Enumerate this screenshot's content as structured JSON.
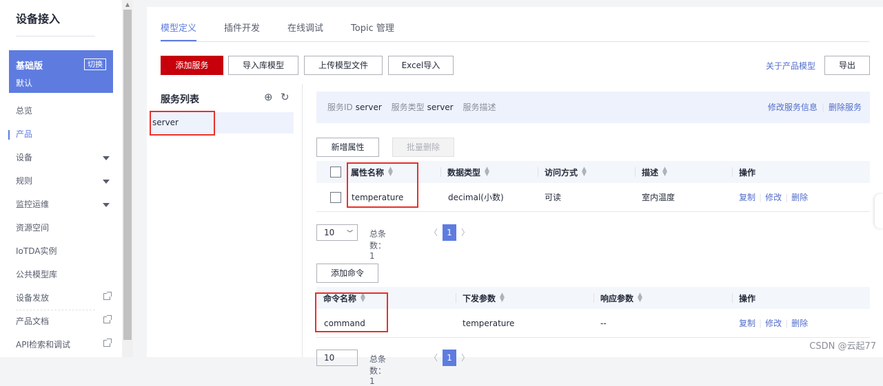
{
  "sidebar": {
    "title": "设备接入",
    "edition": {
      "name": "基础版",
      "sub": "默认",
      "switch": "切换"
    },
    "items": [
      {
        "label": "总览"
      },
      {
        "label": "产品"
      },
      {
        "label": "设备"
      },
      {
        "label": "规则"
      },
      {
        "label": "监控运维"
      },
      {
        "label": "资源空间"
      },
      {
        "label": "IoTDA实例"
      },
      {
        "label": "公共模型库"
      },
      {
        "label": "设备发放"
      },
      {
        "label": "产品文档"
      },
      {
        "label": "API检索和调试"
      }
    ]
  },
  "tabs": [
    "模型定义",
    "插件开发",
    "在线调试",
    "Topic 管理"
  ],
  "toolbar": {
    "add_service": "添加服务",
    "import_lib": "导入库模型",
    "upload_model": "上传模型文件",
    "excel_import": "Excel导入",
    "about_model": "关于产品模型",
    "export": "导出"
  },
  "service_list": {
    "title": "服务列表",
    "items": [
      "server"
    ]
  },
  "service_info": {
    "id_label": "服务ID",
    "id_value": "server",
    "type_label": "服务类型",
    "type_value": "server",
    "desc_label": "服务描述",
    "edit": "修改服务信息",
    "delete": "删除服务"
  },
  "properties": {
    "add_btn": "新增属性",
    "batch_delete": "批量删除",
    "headers": [
      "属性名称",
      "数据类型",
      "访问方式",
      "描述",
      "操作"
    ],
    "rows": [
      {
        "name": "temperature",
        "type": "decimal(小数)",
        "access": "可读",
        "desc": "室内温度"
      }
    ]
  },
  "row_ops": {
    "copy": "复制",
    "edit": "修改",
    "delete": "删除"
  },
  "pagination": {
    "size": "10",
    "total_label": "总条数：1",
    "current": "1"
  },
  "commands": {
    "add_btn": "添加命令",
    "headers": [
      "命令名称",
      "下发参数",
      "响应参数",
      "操作"
    ],
    "rows": [
      {
        "name": "command",
        "params": "temperature",
        "response": "--"
      }
    ]
  },
  "pagination2": {
    "size": "10",
    "total_label": "总条数：1",
    "current": "1"
  },
  "watermark": "CSDN @云起77"
}
